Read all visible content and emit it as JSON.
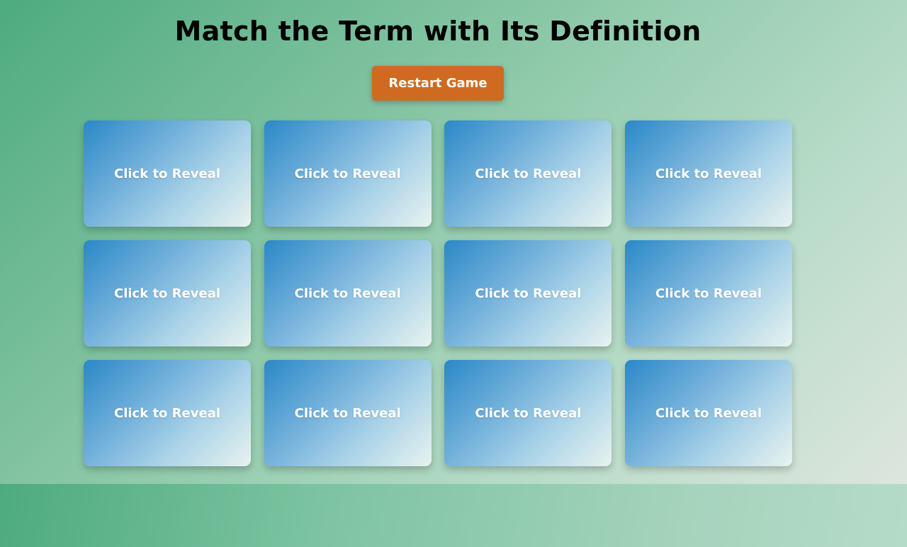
{
  "game": {
    "title": "Match the Term with Its Definition",
    "restart_label": "Restart Game"
  },
  "cards": [
    {
      "label": "Click to Reveal"
    },
    {
      "label": "Click to Reveal"
    },
    {
      "label": "Click to Reveal"
    },
    {
      "label": "Click to Reveal"
    },
    {
      "label": "Click to Reveal"
    },
    {
      "label": "Click to Reveal"
    },
    {
      "label": "Click to Reveal"
    },
    {
      "label": "Click to Reveal"
    },
    {
      "label": "Click to Reveal"
    },
    {
      "label": "Click to Reveal"
    },
    {
      "label": "Click to Reveal"
    },
    {
      "label": "Click to Reveal"
    }
  ],
  "colors": {
    "button": "#d06a21",
    "card_start": "#2a88c8",
    "card_end": "#e8f3ef",
    "background_start": "#4eab7f",
    "background_end": "#e3e7e1"
  }
}
